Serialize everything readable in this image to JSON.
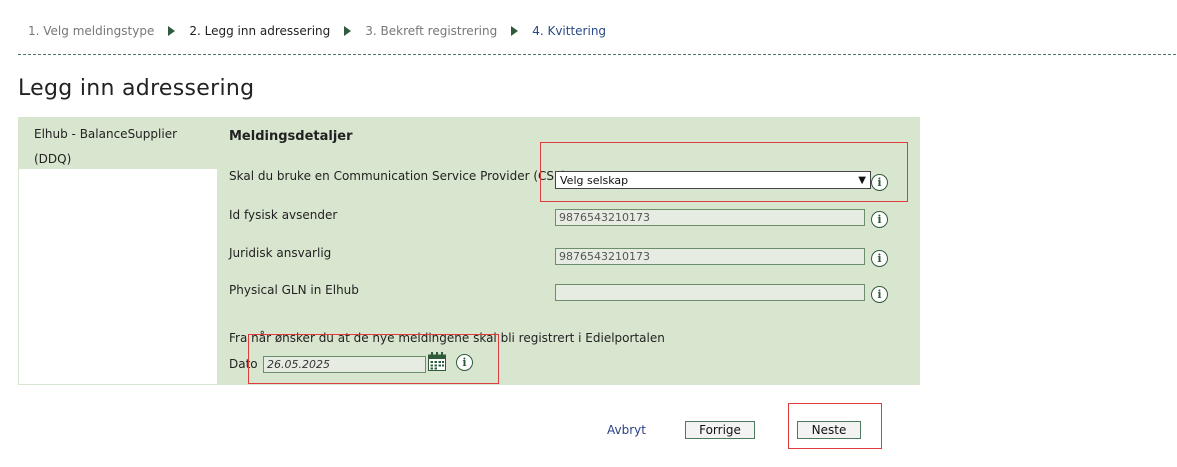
{
  "steps": [
    {
      "label": "1. Velg meldingstype"
    },
    {
      "label": "2. Legg inn adressering"
    },
    {
      "label": "3. Bekreft registrering"
    },
    {
      "label": "4. Kvittering"
    }
  ],
  "page_title": "Legg inn adressering",
  "sidebar": {
    "line1": "Elhub - BalanceSupplier",
    "line2": "(DDQ)"
  },
  "section": {
    "title": "Meldingsdetaljer",
    "csp_label": "Skal du bruke en Communication Service Provider (CSP)?",
    "csp_value": "Velg selskap",
    "sender_label": "Id fysisk avsender",
    "sender_value": "9876543210173",
    "legal_label": "Juridisk ansvarlig",
    "legal_value": "9876543210173",
    "gln_label": "Physical GLN in Elhub",
    "gln_value": "",
    "from_label": "Fra når ønsker du at de nye meldingene skal bli registrert i Edielportalen",
    "date_label": "Dato",
    "date_value": "26.05.2025"
  },
  "actions": {
    "cancel": "Avbryt",
    "previous": "Forrige",
    "next": "Neste"
  },
  "colors": {
    "panel": "#d9e6cf",
    "accent": "#2f5b3c",
    "highlight": "#e03c3c",
    "link": "#2a3f86"
  },
  "icons": [
    "chevron-right-icon",
    "chevron-down-icon",
    "info-icon",
    "calendar-icon"
  ]
}
